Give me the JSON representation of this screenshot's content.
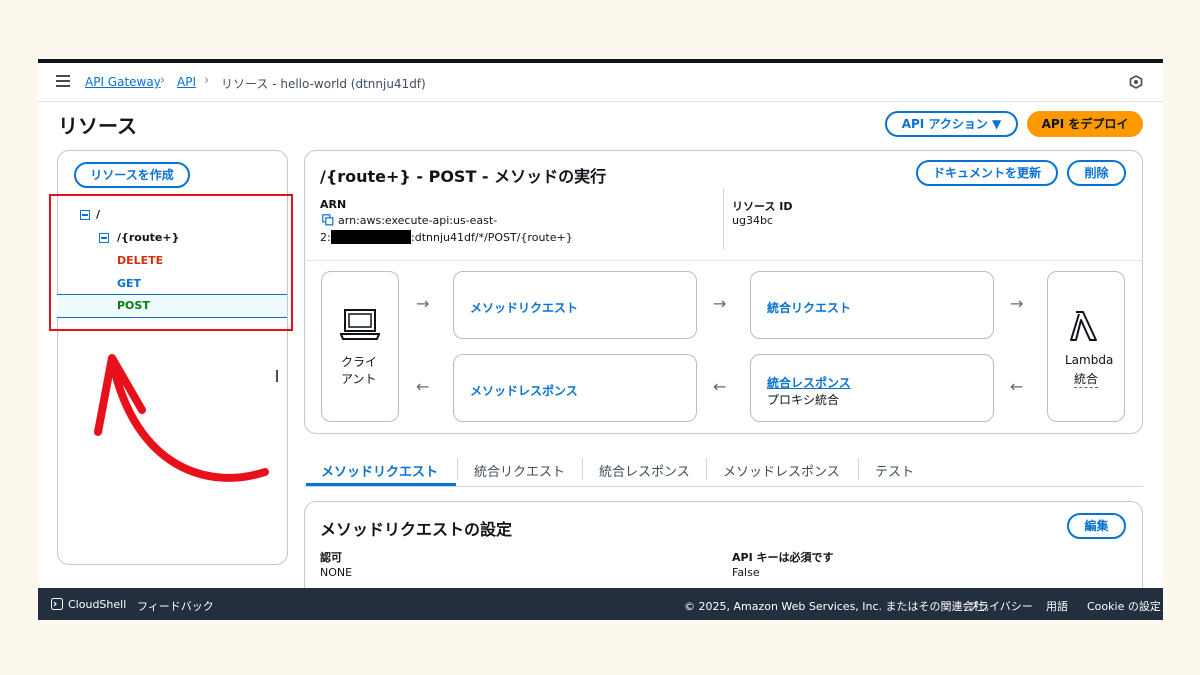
{
  "breadcrumb": {
    "items": [
      "API Gateway",
      "API"
    ],
    "current": "リソース - hello-world (dtnnju41df)",
    "separator": "›"
  },
  "page": {
    "title": "リソース"
  },
  "header_actions": {
    "api_actions": "API アクション ▼",
    "deploy": "API をデプロイ"
  },
  "sidebar": {
    "create_button": "リソースを作成",
    "tree": {
      "root": "/",
      "child": "/{route+}",
      "methods": [
        {
          "label": "DELETE",
          "color": "#d13212"
        },
        {
          "label": "GET",
          "color": "#0972d3"
        },
        {
          "label": "POST",
          "color": "#037f0c"
        }
      ]
    }
  },
  "method": {
    "title": "/{route+} - POST - メソッドの実行",
    "update_doc": "ドキュメントを更新",
    "delete": "削除",
    "arn_label": "ARN",
    "arn_line1": "arn:aws:execute-api:us-east-",
    "arn_line2_prefix": "2:",
    "arn_line2_suffix": ":dtnnju41df/*/POST/{route+}",
    "resource_id_label": "リソース ID",
    "resource_id": "ug34bc"
  },
  "flow": {
    "client_line1": "クライ",
    "client_line2": "アント",
    "method_request": "メソッドリクエスト",
    "integration_request": "統合リクエスト",
    "method_response": "メソッドレスポンス",
    "integration_response": "統合レスポンス",
    "integration_response_sub": "プロキシ統合",
    "lambda_line1": "Lambda",
    "lambda_line2": "統合",
    "arrow_right": "→",
    "arrow_left": "←"
  },
  "tabs": [
    {
      "label": "メソッドリクエスト",
      "active": true
    },
    {
      "label": "統合リクエスト"
    },
    {
      "label": "統合レスポンス"
    },
    {
      "label": "メソッドレスポンス"
    },
    {
      "label": "テスト"
    }
  ],
  "settings": {
    "title": "メソッドリクエストの設定",
    "edit": "編集",
    "auth_label": "認可",
    "auth_value": "NONE",
    "apikey_label": "API キーは必須です",
    "apikey_value": "False"
  },
  "footer": {
    "cloudshell": "CloudShell",
    "feedback": "フィードバック",
    "copyright": "© 2025, Amazon Web Services, Inc. またはその関連会社。",
    "privacy": "プライバシー",
    "terms": "用語",
    "cookie": "Cookie の設定"
  },
  "colors": {
    "accent": "#0972d3",
    "deploy": "#ff9900",
    "annotation": "#e8111b"
  }
}
